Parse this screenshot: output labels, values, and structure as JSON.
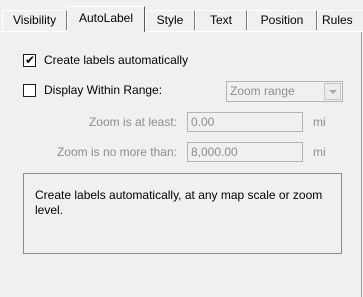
{
  "tabs": [
    {
      "label": "Visibility",
      "active": false
    },
    {
      "label": "AutoLabel",
      "active": true
    },
    {
      "label": "Style",
      "active": false
    },
    {
      "label": "Text",
      "active": false
    },
    {
      "label": "Position",
      "active": false
    },
    {
      "label": "Rules",
      "active": false
    }
  ],
  "create_labels": {
    "label": "Create labels automatically",
    "checked": true
  },
  "display_within_range": {
    "label": "Display Within Range:",
    "checked": false
  },
  "range_combo": {
    "value": "Zoom range",
    "enabled": false
  },
  "zoom_min": {
    "label": "Zoom is at least:",
    "value": "0.00",
    "unit": "mi"
  },
  "zoom_max": {
    "label": "Zoom is no more than:",
    "value": "8,000.00",
    "unit": "mi"
  },
  "description": "Create labels automatically, at any map scale or zoom level.",
  "colors": {
    "disabled_text": "#8d8d8d",
    "background": "#f0f0f0"
  }
}
